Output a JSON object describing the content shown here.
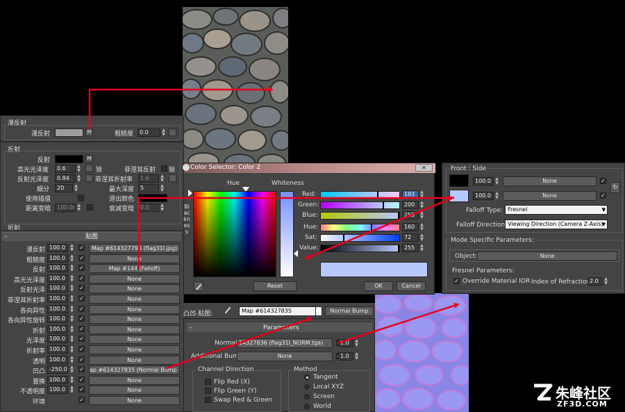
{
  "diffuse_panel": {
    "title": "漫反射",
    "diffuse_label": "漫反射",
    "m": "M",
    "roughness_label": "粗糙度",
    "roughness_value": "0.0"
  },
  "reflect_panel": {
    "title": "反射",
    "reflect_label": "反射",
    "m": "M",
    "hilight_label": "高光光泽度",
    "hilight_value": "0.6",
    "lock_label": "锁",
    "fresnel_label": "菲涅耳反射",
    "lock2_label": "锁",
    "gloss_label": "反射光泽度",
    "gloss_value": "0.84",
    "fresnel_ior_label": "菲涅耳折射率",
    "fresnel_ior_value": "1.6",
    "subdiv_label": "细分",
    "subdiv_value": "20",
    "maxdepth_label": "最大深度",
    "maxdepth_value": "5",
    "interp_label": "使用插值",
    "exitcolor_label": "退出颜色",
    "dim_label": "距离变暗",
    "dim_value": "100.0n",
    "dimfalloff_label": "衰减变暗",
    "dimfalloff_value": "0.0",
    "refract_title": "折射"
  },
  "maps": {
    "title": "贴图",
    "rows": [
      {
        "label": "漫反射",
        "amount": "100.0",
        "checked": "✓",
        "map": "Map #614327796  (flag31l.jpg)"
      },
      {
        "label": "粗糙度",
        "amount": "100.0",
        "checked": "✓",
        "map": "None"
      },
      {
        "label": "反射",
        "amount": "100.0",
        "checked": "✓",
        "map": "Map #144  (Falloff)"
      },
      {
        "label": "高光光泽度",
        "amount": "100.0",
        "checked": "✓",
        "map": "None"
      },
      {
        "label": "反射光泽",
        "amount": "100.0",
        "checked": "✓",
        "map": "None"
      },
      {
        "label": "菲涅耳折射率",
        "amount": "100.0",
        "checked": "✓",
        "map": "None"
      },
      {
        "label": "各向异性",
        "amount": "100.0",
        "checked": "✓",
        "map": "None"
      },
      {
        "label": "各向异性旋转",
        "amount": "100.0",
        "checked": "✓",
        "map": "None"
      },
      {
        "label": "折射",
        "amount": "100.0",
        "checked": "✓",
        "map": "None"
      },
      {
        "label": "光泽度",
        "amount": "100.0",
        "checked": "✓",
        "map": "None"
      },
      {
        "label": "折射率",
        "amount": "100.0",
        "checked": "✓",
        "map": "None"
      },
      {
        "label": "透明",
        "amount": "100.0",
        "checked": "✓",
        "map": "None"
      },
      {
        "label": "凹凸",
        "amount": "-250.0",
        "checked": "✓",
        "map": "ap #614327835  (Normal Bump )"
      },
      {
        "label": "置换",
        "amount": "100.0",
        "checked": "✓",
        "map": "None"
      },
      {
        "label": "不透明度",
        "amount": "100.0",
        "checked": "✓",
        "map": "None"
      },
      {
        "label": "环境",
        "amount": "",
        "checked": "✓",
        "map": "None"
      }
    ]
  },
  "color_selector": {
    "title": "Color Selector: Color 2",
    "close": "✕",
    "hue_label": "Hue",
    "whiteness_label": "Whiteness",
    "blackness_label": "Blackness",
    "red_label": "Red:",
    "red_value": "183",
    "green_label": "Green:",
    "green_value": "200",
    "blue_label": "Blue:",
    "blue_value": "255",
    "hue2_label": "Hue:",
    "hue2_value": "160",
    "sat_label": "Sat:",
    "sat_value": "72",
    "value_label": "Value:",
    "value_value": "255",
    "reset": "Reset",
    "ok": "OK",
    "cancel": "Cancel",
    "color": "#b7c8ff"
  },
  "falloff": {
    "front_side": "Front : Side",
    "front_amount": "100.0",
    "front_map": "None",
    "side_amount": "100.0",
    "side_map": "None",
    "type_label": "Falloff Type:",
    "type_value": "Fresnel",
    "direction_label": "Falloff Direction:",
    "direction_value": "Viewing Direction (Camera Z-Axis)",
    "mode_title": "Mode Specific Parameters:",
    "object_label": "Object:",
    "object_value": "None",
    "fresnel_params": "Fresnel Parameters:",
    "override_label": "Override Material IOR",
    "ior_label": "Index of Refraction",
    "ior_value": "2.0"
  },
  "bump": {
    "label": "凸凹-贴图:",
    "map_name": "Map #614327835",
    "type": "Normal Bump",
    "params_title": "Parameters",
    "normal_label": "Normal:",
    "normal_map": "14327836 (flag31l_NORM.tga)",
    "normal_amount": "1.0",
    "additional_label": "Additional Bump:",
    "additional_map": "None",
    "additional_amount": "1.0",
    "channel_title": "Channel Direction",
    "flip_red": "Flip Red (X)",
    "flip_green": "Flip Green (Y)",
    "swap": "Swap Red & Green",
    "method_title": "Method",
    "m_tangent": "Tangent",
    "m_local": "Local XYZ",
    "m_screen": "Screen",
    "m_world": "World"
  },
  "watermark": {
    "brand": "朱峰社区",
    "site": "ZF3D.COM"
  }
}
